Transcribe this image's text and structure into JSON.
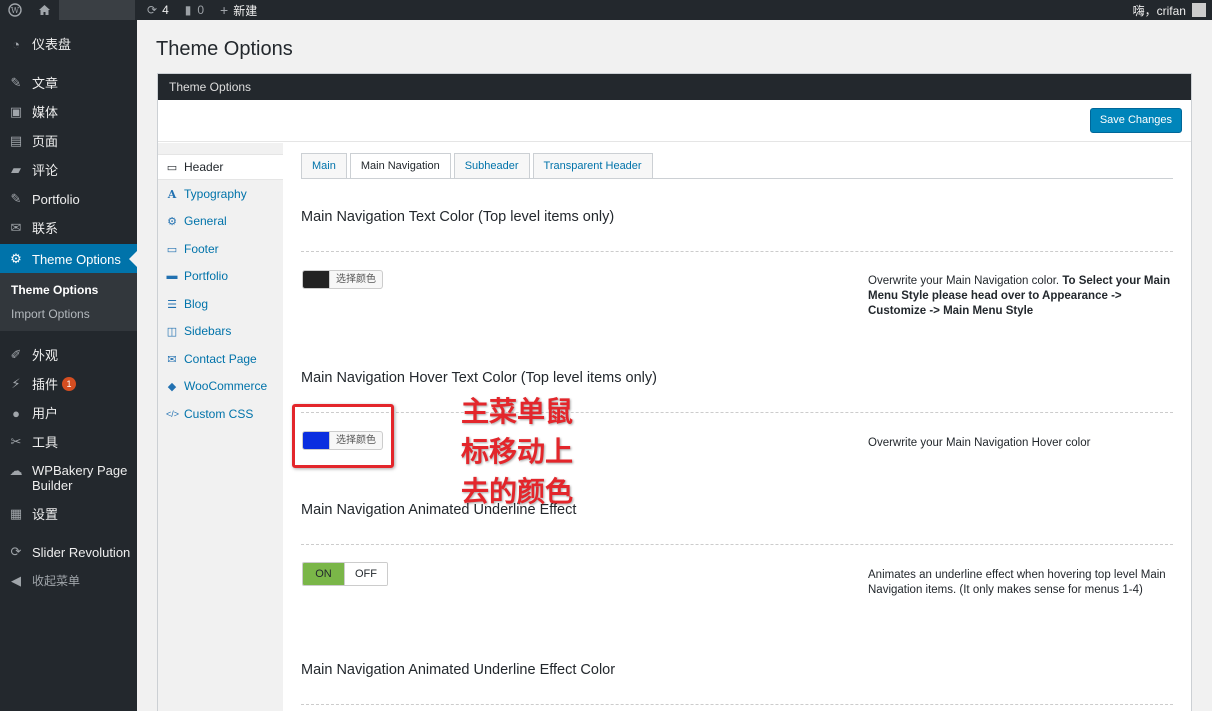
{
  "adminbar": {
    "update_count": "4",
    "comment_count": "0",
    "new_label": "新建",
    "greeting": "嗨，crifan"
  },
  "sidebar": {
    "items": [
      {
        "label": "仪表盘",
        "icon": "dashboard-icon"
      },
      {
        "label": "文章",
        "icon": "pin-icon"
      },
      {
        "label": "媒体",
        "icon": "media-icon"
      },
      {
        "label": "页面",
        "icon": "page-icon"
      },
      {
        "label": "评论",
        "icon": "comment-icon"
      },
      {
        "label": "Portfolio",
        "icon": "pin-icon"
      },
      {
        "label": "联系",
        "icon": "mail-icon"
      },
      {
        "label": "Theme Options",
        "icon": "gear-icon"
      },
      {
        "label": "外观",
        "icon": "brush-icon"
      },
      {
        "label": "插件",
        "icon": "plugin-icon",
        "badge": "1"
      },
      {
        "label": "用户",
        "icon": "user-icon"
      },
      {
        "label": "工具",
        "icon": "wrench-icon"
      },
      {
        "label": "WPBakery Page",
        "label2": "Builder",
        "icon": "cloud-icon"
      },
      {
        "label": "设置",
        "icon": "settings-icon"
      },
      {
        "label": "Slider Revolution",
        "icon": "refresh-icon"
      },
      {
        "label": "收起菜单",
        "icon": "collapse-icon"
      }
    ],
    "submenu": [
      "Theme Options",
      "Import Options"
    ]
  },
  "page": {
    "title": "Theme Options",
    "panel_title": "Theme Options",
    "save_label": "Save Changes"
  },
  "panel_nav": [
    {
      "label": "Header",
      "icon": "monitor-icon"
    },
    {
      "label": "Typography",
      "icon": "typography-icon"
    },
    {
      "label": "General",
      "icon": "gear-icon"
    },
    {
      "label": "Footer",
      "icon": "monitor-icon"
    },
    {
      "label": "Portfolio",
      "icon": "briefcase-icon"
    },
    {
      "label": "Blog",
      "icon": "list-icon"
    },
    {
      "label": "Sidebars",
      "icon": "columns-icon"
    },
    {
      "label": "Contact Page",
      "icon": "envelope-icon"
    },
    {
      "label": "WooCommerce",
      "icon": "tag-icon"
    },
    {
      "label": "Custom CSS",
      "icon": "code-icon"
    }
  ],
  "tabs": [
    "Main",
    "Main Navigation",
    "Subheader",
    "Transparent Header"
  ],
  "sections": {
    "text_color": {
      "title": "Main Navigation Text Color (Top level items only)",
      "picker_label": "选择颜色",
      "swatch_color": "#222222",
      "desc_plain": "Overwrite your Main Navigation color. ",
      "desc_bold": "To Select your Main Menu Style please head over to Appearance -> Customize -> Main Menu Style"
    },
    "hover_color": {
      "title": "Main Navigation Hover Text Color (Top level items only)",
      "picker_label": "选择颜色",
      "swatch_color": "#0a2ee0",
      "desc": "Overwrite your Main Navigation Hover color"
    },
    "underline": {
      "title": "Main Navigation Animated Underline Effect",
      "on_label": "ON",
      "off_label": "OFF",
      "desc": "Animates an underline effect when hovering top level Main Navigation items. (It only makes sense for menus 1-4)"
    },
    "underline_color": {
      "title": "Main Navigation Animated Underline Effect Color"
    }
  },
  "annotation": {
    "text": "主菜单鼠标移动上去的颜色",
    "color": "#e3262b"
  },
  "colors": {
    "accent": "#0073aa",
    "adminbar": "#23282d",
    "toggle_on": "#7ab648"
  }
}
